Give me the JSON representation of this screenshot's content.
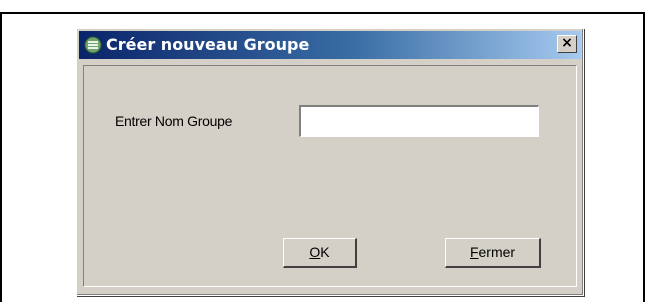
{
  "dialog": {
    "title": "Créer nouveau Groupe",
    "close_glyph": "×",
    "icon": "group-icon"
  },
  "form": {
    "label": "Entrer Nom Groupe",
    "value": "",
    "placeholder": ""
  },
  "buttons": {
    "ok_mnemonic": "O",
    "ok_rest": "K",
    "close_mnemonic": "F",
    "close_rest": "ermer"
  },
  "colors": {
    "titlebar_start": "#0a246a",
    "titlebar_end": "#a6caf0",
    "dialog_face": "#d4d0c8"
  }
}
